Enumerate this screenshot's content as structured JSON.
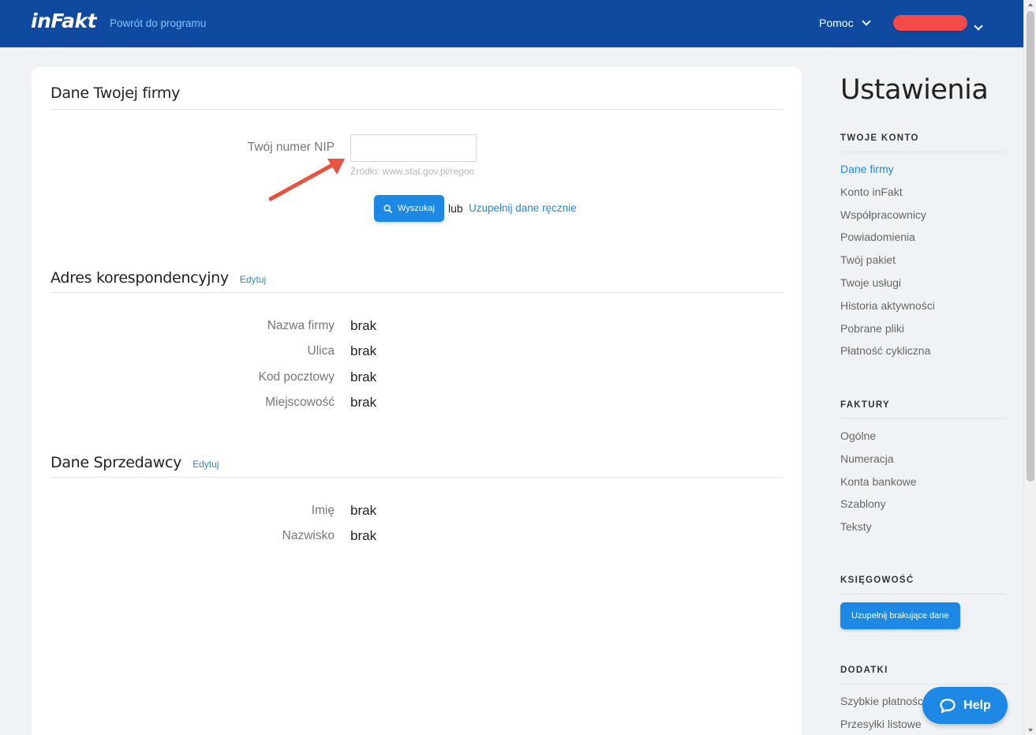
{
  "header": {
    "logo": "inFakt",
    "back_link": "Powrót do programu",
    "help_menu": "Pomoc"
  },
  "company": {
    "title": "Dane Twojej firmy",
    "nip_label": "Twój numer NIP",
    "nip_value": "",
    "nip_source": "Źródło: www.stat.gov.pl/regon",
    "search_button": "Wyszukaj",
    "or_text": "lub",
    "manual_link": "Uzupełnij dane ręcznie"
  },
  "address": {
    "title": "Adres korespondencyjny",
    "edit": "Edytuj",
    "rows": [
      {
        "label": "Nazwa firmy",
        "value": "brak"
      },
      {
        "label": "Ulica",
        "value": "brak"
      },
      {
        "label": "Kod pocztowy",
        "value": "brak"
      },
      {
        "label": "Miejscowość",
        "value": "brak"
      }
    ]
  },
  "seller": {
    "title": "Dane Sprzedawcy",
    "edit": "Edytuj",
    "rows": [
      {
        "label": "Imię",
        "value": "brak"
      },
      {
        "label": "Nazwisko",
        "value": "brak"
      }
    ]
  },
  "sidebar": {
    "title": "Ustawienia",
    "account": {
      "heading": "TWOJE KONTO",
      "items": [
        "Dane firmy",
        "Konto inFakt",
        "Współpracownicy",
        "Powiadomienia",
        "Twój pakiet",
        "Twoje usługi",
        "Historia aktywności",
        "Pobrane pliki",
        "Płatność cykliczna"
      ]
    },
    "invoices": {
      "heading": "FAKTURY",
      "items": [
        "Ogólne",
        "Numeracja",
        "Konta bankowe",
        "Szablony",
        "Teksty"
      ]
    },
    "accounting": {
      "heading": "KSIĘGOWOŚĆ",
      "button": "Uzupełnij brakujące dane"
    },
    "addons": {
      "heading": "DODATKI",
      "items": [
        "Szybkie płatności",
        "Przesyłki listowe"
      ]
    }
  },
  "help_button": "Help",
  "colors": {
    "topbar": "#0f4aa0",
    "accent": "#1e88e5",
    "user_pill": "#f44a4a",
    "arrow": "#e8523f"
  }
}
